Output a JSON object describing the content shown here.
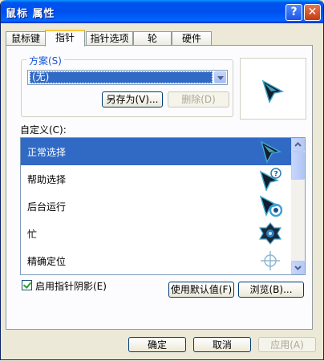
{
  "window": {
    "title": "鼠标 属性",
    "help_glyph": "?",
    "close_glyph": "✕"
  },
  "tabs": [
    {
      "label": "鼠标键"
    },
    {
      "label": "指针"
    },
    {
      "label": "指针选项"
    },
    {
      "label": "轮"
    },
    {
      "label": "硬件"
    }
  ],
  "scheme": {
    "legend": "方案(S)",
    "selected": "(无)",
    "save_as_label": "另存为(V)...",
    "delete_label": "删除(D)"
  },
  "customize": {
    "label": "自定义(C):",
    "items": [
      {
        "label": "正常选择",
        "icon": "normal-select-cursor"
      },
      {
        "label": "帮助选择",
        "icon": "help-select-cursor"
      },
      {
        "label": "后台运行",
        "icon": "working-in-background-cursor"
      },
      {
        "label": "忙",
        "icon": "busy-cursor"
      },
      {
        "label": "精确定位",
        "icon": "precision-crosshair-cursor"
      }
    ]
  },
  "shadow_checkbox": {
    "label": "启用指针阴影(E)",
    "checked": true
  },
  "use_default_label": "使用默认值(F)",
  "browse_label": "浏览(B)...",
  "footer": {
    "ok_label": "确定",
    "cancel_label": "取消",
    "apply_label": "应用(A)"
  },
  "colors": {
    "selection": "#316ac5",
    "titlebar": "#0053ee",
    "legend": "#1b56d6"
  }
}
